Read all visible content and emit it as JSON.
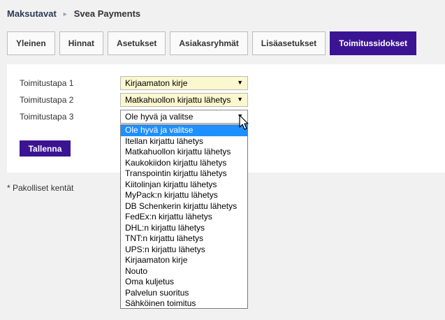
{
  "breadcrumb": {
    "parent": "Maksutavat",
    "separator_icon": "chevron-right-icon",
    "current": "Svea Payments"
  },
  "tabs": [
    {
      "label": "Yleinen",
      "active": false
    },
    {
      "label": "Hinnat",
      "active": false
    },
    {
      "label": "Asetukset",
      "active": false
    },
    {
      "label": "Asiakasryhmät",
      "active": false
    },
    {
      "label": "Lisäasetukset",
      "active": false
    },
    {
      "label": "Toimitussidokset",
      "active": true
    }
  ],
  "form": {
    "rows": [
      {
        "label": "Toimitustapa 1",
        "value": "Kirjaamaton kirje"
      },
      {
        "label": "Toimitustapa 2",
        "value": "Matkahuollon kirjattu lähetys"
      },
      {
        "label": "Toimitustapa 3",
        "value": "Ole hyvä ja valitse"
      }
    ],
    "save_label": "Tallenna"
  },
  "required_note": "* Pakolliset kentät",
  "dropdown": {
    "selected_index": 0,
    "options": [
      "Ole hyvä ja valitse",
      "Itellan kirjattu lähetys",
      "Matkahuollon kirjattu lähetys",
      "Kaukokiidon kirjattu lähetys",
      "Transpointin kirjattu lähetys",
      "Kiitolinjan kirjattu lähetys",
      "MyPack:n kirjattu lähetys",
      "DB Schenkerin kirjattu lähetys",
      "FedEx:n kirjattu lähetys",
      "DHL:n kirjattu lähetys",
      "TNT:n kirjattu lähetys",
      "UPS:n kirjattu lähetys",
      "Kirjaamaton kirje",
      "Nouto",
      "Oma kuljetus",
      "Palvelun suoritus",
      "Sähköinen toimitus"
    ]
  },
  "colors": {
    "accent": "#3b1493",
    "select_filled": "#fbf7cf",
    "option_highlight": "#1e90ff"
  }
}
